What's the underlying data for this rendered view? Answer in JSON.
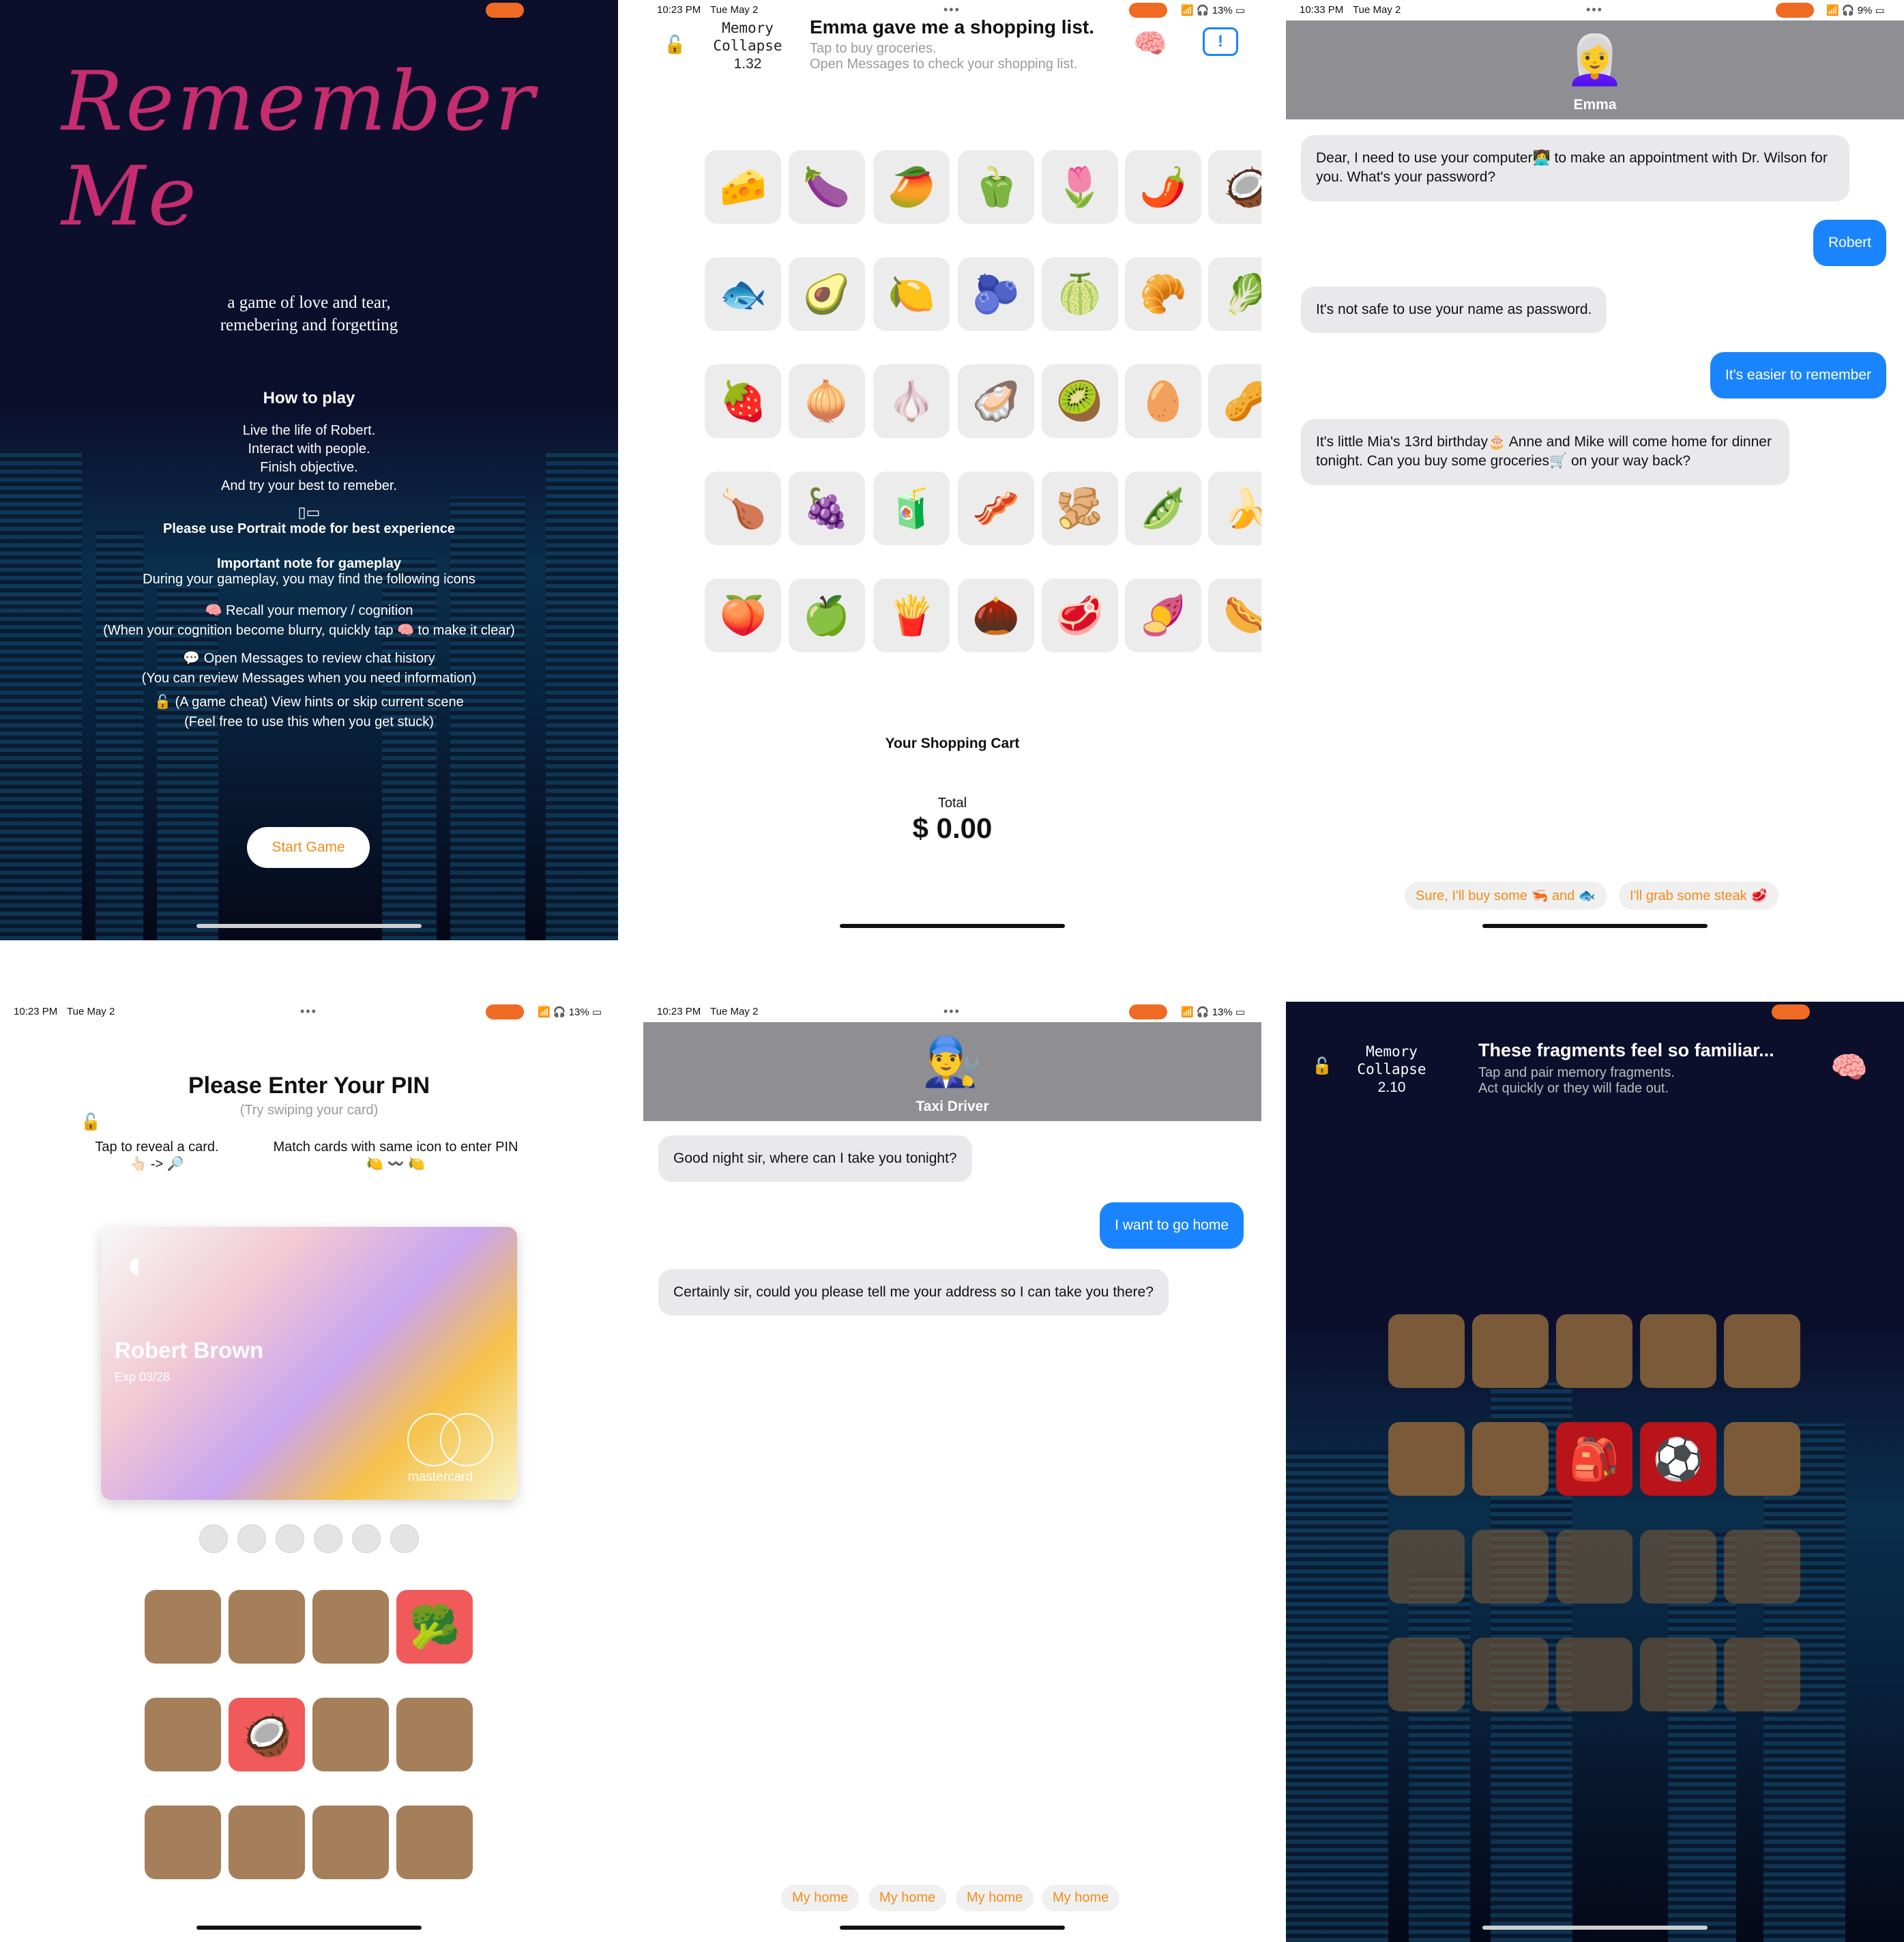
{
  "panel1": {
    "title_art": "Remember Me",
    "tagline_1": "a game of love and tear,",
    "tagline_2": "remebering and forgetting",
    "how_to_play": "How to play",
    "lines": [
      "Live the life of Robert.",
      "Interact with people.",
      "Finish objective.",
      "And try your best to remeber."
    ],
    "portrait_note": "Please use Portrait mode for best experience",
    "important_title": "Important note for gameplay",
    "important_sub": "During your gameplay, you may find the following icons",
    "icon_notes": [
      "Recall your memory / cognition",
      "(When your cognition become blurry, quickly tap 🧠 to make it clear)",
      "Open Messages to review chat history",
      "(You can review Messages when you need information)",
      "(A game cheat) View hints or skip current scene",
      "(Feel free to use this when you get stuck)"
    ],
    "start_button": "Start Game"
  },
  "panel2": {
    "time": "10:23 PM",
    "date": "Tue May 2",
    "battery": "13%",
    "stat_label_1": "Memory",
    "stat_label_2": "Collapse",
    "stat_value": "1.32",
    "title": "Emma gave me a shopping list.",
    "subtitle_1": "Tap to buy groceries.",
    "subtitle_2": "Open Messages to check your shopping list.",
    "items": [
      "🧀",
      "🍆",
      "🥭",
      "🫑",
      "🌷",
      "🌶️",
      "🥥",
      "🐟",
      "🥑",
      "🍋",
      "🫐",
      "🍈",
      "🥐",
      "🥬",
      "🍓",
      "🧅",
      "🧄",
      "🦪",
      "🥝",
      "🥚",
      "🥜",
      "🍗",
      "🍇",
      "🧃",
      "🥓",
      "🫚",
      "🫛",
      "🍌",
      "🍑",
      "🍏",
      "🍟",
      "🌰",
      "🥩",
      "🍠",
      "🌭"
    ],
    "cart_label": "Your Shopping Cart",
    "total_label": "Total",
    "total_value": "$ 0.00"
  },
  "panel3": {
    "time": "10:33 PM",
    "date": "Tue May 2",
    "battery": "9%",
    "contact": "Emma",
    "avatar": "👩‍🦳",
    "messages": [
      {
        "from": "in",
        "text": "Dear, I need to use your computer👩‍💻 to make an appointment with Dr. Wilson for you. What's your password?"
      },
      {
        "from": "out",
        "text": "Robert"
      },
      {
        "from": "in",
        "text": "It's not safe to use your name as password."
      },
      {
        "from": "out",
        "text": "It's easier to remember"
      },
      {
        "from": "in",
        "text": "It's little Mia's 13rd birthday🎂 Anne and Mike will come home for dinner tonight. Can you buy some groceries🛒 on your way back?"
      }
    ],
    "replies": [
      "Sure, I'll buy some 🦐 and 🐟",
      "I'll grab some steak 🥩"
    ]
  },
  "panel4": {
    "time": "10:23 PM",
    "date": "Tue May 2",
    "battery": "13%",
    "title": "Please Enter Your PIN",
    "subtitle": "(Try swiping your card)",
    "hint_1": "Tap to reveal a card.",
    "hint_1_icons": "👆🏻 -> 🔎",
    "hint_2": "Match cards with same icon to enter PIN",
    "hint_2_icons": "🍋 〰️ 🍋",
    "card_name": "Robert Brown",
    "card_exp": "Exp  03/28",
    "card_brand": "mastercard",
    "revealed": [
      "🥦",
      "🥥"
    ]
  },
  "panel5": {
    "time": "10:23 PM",
    "date": "Tue May 2",
    "battery": "13%",
    "contact": "Taxi Driver",
    "avatar": "👨‍🔧",
    "messages": [
      {
        "from": "in",
        "text": "Good night sir, where can I take you tonight?"
      },
      {
        "from": "out",
        "text": "I want to go home"
      },
      {
        "from": "in",
        "text": "Certainly sir, could you please tell me your address so I can take you there?"
      }
    ],
    "replies": [
      "My home",
      "My home",
      "My home",
      "My home"
    ]
  },
  "panel6": {
    "stat_label_1": "Memory",
    "stat_label_2": "Collapse",
    "stat_value": "2.10",
    "title": "These fragments feel so familiar...",
    "subtitle_1": "Tap and pair memory fragments.",
    "subtitle_2": "Act quickly or they will fade out.",
    "revealed": [
      "🎒",
      "⚽"
    ]
  },
  "colors": {
    "accent": "#ef6a23",
    "bubble_out": "#1a84ff",
    "bubble_in": "#e9e9eb",
    "tile_brown": "#a57e5a",
    "tile_red": "#f05a5a"
  }
}
